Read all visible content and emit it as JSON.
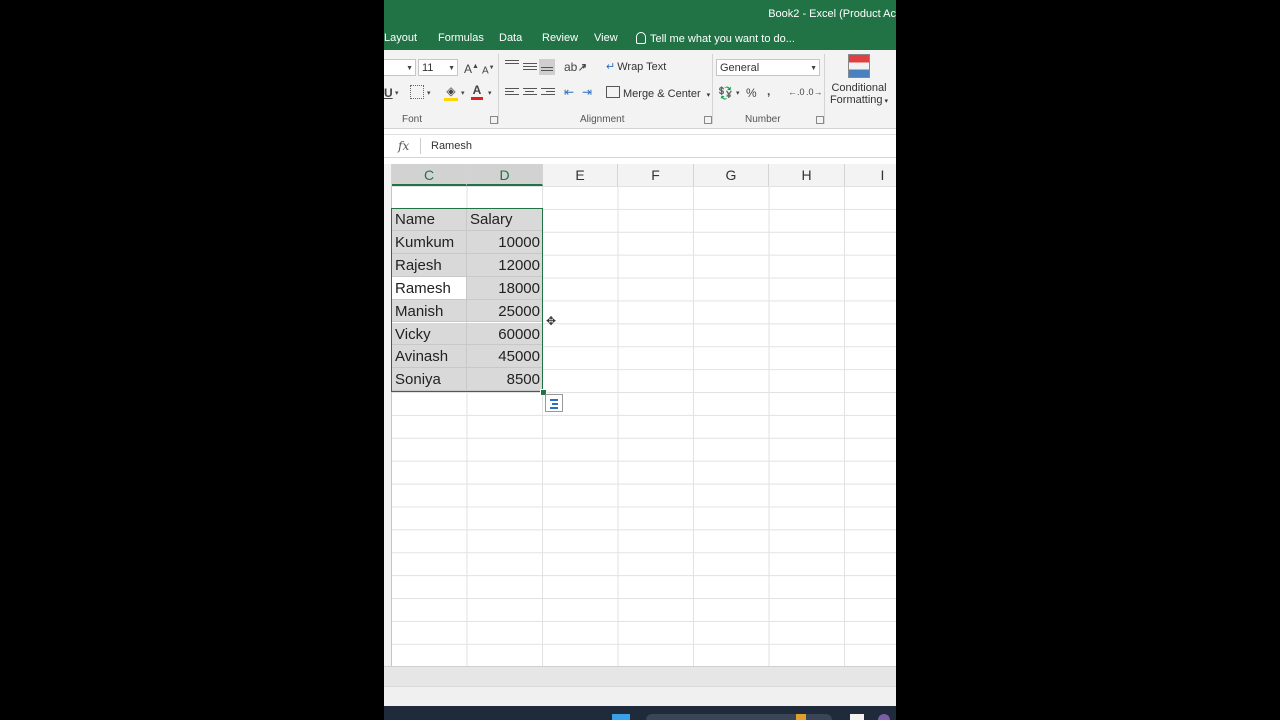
{
  "window": {
    "title": "Book2 - Excel (Product Ac"
  },
  "tabs": [
    "Layout",
    "Formulas",
    "Data",
    "Review",
    "View"
  ],
  "tell_me": "Tell me what you want to do...",
  "ribbon": {
    "font_size": "11",
    "number_format": "General",
    "wrap_text": "Wrap Text",
    "merge_center": "Merge & Center",
    "conditional_formatting": [
      "Conditional",
      "Formatting"
    ],
    "group_labels": {
      "font": "Font",
      "alignment": "Alignment",
      "number": "Number"
    }
  },
  "formula_bar": {
    "fx": "fx",
    "value": "Ramesh"
  },
  "columns": [
    "C",
    "D",
    "E",
    "F",
    "G",
    "H",
    "I"
  ],
  "selected_columns": [
    "C",
    "D"
  ],
  "table": {
    "headers": [
      "Name",
      "Salary"
    ],
    "rows": [
      [
        "Kumkum",
        "10000"
      ],
      [
        "Rajesh",
        "12000"
      ],
      [
        "Ramesh",
        "18000"
      ],
      [
        "Manish",
        "25000"
      ],
      [
        "Vicky",
        "60000"
      ],
      [
        "Avinash",
        "45000"
      ],
      [
        "Soniya",
        "8500"
      ]
    ]
  },
  "colors": {
    "accent": "#217346",
    "selection_fill": "#d9d9d9"
  }
}
